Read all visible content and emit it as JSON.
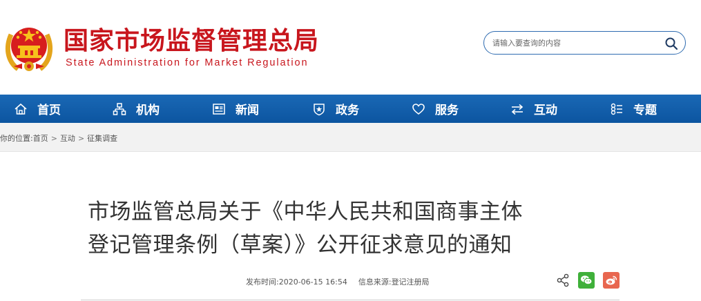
{
  "site": {
    "title_cn": "国家市场监督管理总局",
    "title_en": "State Administration for Market Regulation"
  },
  "search": {
    "placeholder": "请输入要查询的内容"
  },
  "nav": [
    {
      "label": "首页",
      "icon": "home-icon"
    },
    {
      "label": "机构",
      "icon": "org-chart-icon"
    },
    {
      "label": "新闻",
      "icon": "news-icon"
    },
    {
      "label": "政务",
      "icon": "government-badge-icon"
    },
    {
      "label": "服务",
      "icon": "heart-icon"
    },
    {
      "label": "互动",
      "icon": "exchange-arrows-icon"
    },
    {
      "label": "专题",
      "icon": "topic-grid-icon"
    }
  ],
  "breadcrumb": {
    "prefix": "你的位置:",
    "items": [
      "首页",
      "互动",
      "征集调查"
    ],
    "separator": ">"
  },
  "article": {
    "title_line1": "市场监管总局关于《中华人民共和国商事主体",
    "title_line2": "登记管理条例（草案）》公开征求意见的通知",
    "published_label": "发布时间:",
    "published_value": "2020-06-15 16:54",
    "source_label": "信息来源:",
    "source_value": "登记注册局"
  },
  "share": {
    "icons": [
      "share-icon",
      "wechat-icon",
      "weibo-icon"
    ],
    "wechat_color": "#3fb03a",
    "weibo_color": "#e8664f"
  },
  "colors": {
    "brand_red": "#c8161d",
    "nav_blue": "#0c55a0",
    "search_border": "#2e6bb0"
  }
}
